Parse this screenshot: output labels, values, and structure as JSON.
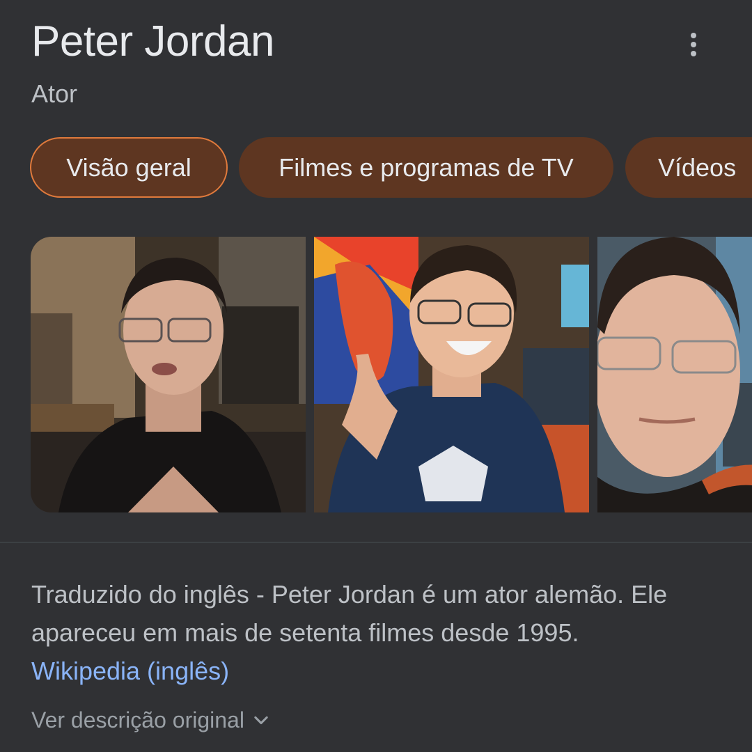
{
  "header": {
    "title": "Peter Jordan",
    "subtitle": "Ator",
    "menu_icon": "more-vert-icon"
  },
  "tabs": [
    {
      "label": "Visão geral",
      "active": true
    },
    {
      "label": "Filmes e programas de TV",
      "active": false
    },
    {
      "label": "Vídeos",
      "active": false
    }
  ],
  "images": [
    {
      "alt": "photo-1"
    },
    {
      "alt": "photo-2"
    },
    {
      "alt": "photo-3"
    }
  ],
  "description": {
    "text": "Traduzido do inglês - Peter Jordan é um ator alemão. Ele apareceu em mais de setenta filmes desde 1995.",
    "source_link": "Wikipedia (inglês)",
    "toggle_label": "Ver descrição original",
    "toggle_icon": "chevron-down-icon"
  },
  "colors": {
    "background": "#303134",
    "chip": "#5e3621",
    "chip_active_border": "#e07a3c",
    "link": "#8ab4f8"
  }
}
